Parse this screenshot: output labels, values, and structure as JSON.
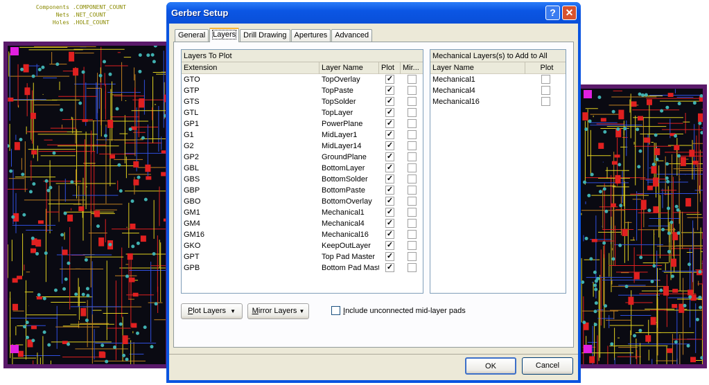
{
  "background": {
    "stats": [
      {
        "label": "Components",
        "value": ".COMPONENT_COUNT"
      },
      {
        "label": "Nets",
        "value": ".NET_COUNT"
      },
      {
        "label": "Holes",
        "value": ".HOLE_COUNT"
      }
    ],
    "colors": {
      "board_border": "#5a1a6a",
      "trace_yellow": "#e0d020",
      "trace_red": "#e02020",
      "trace_blue": "#3050e0",
      "pad_cyan": "#40b0b0",
      "pad_magenta": "#e020e0"
    }
  },
  "dialog": {
    "title": "Gerber Setup",
    "help_label": "?",
    "close_label": "✕",
    "tabs": [
      {
        "label": "General",
        "active": false
      },
      {
        "label": "Layers",
        "active": true
      },
      {
        "label": "Drill Drawing",
        "active": false
      },
      {
        "label": "Apertures",
        "active": false
      },
      {
        "label": "Advanced",
        "active": false
      }
    ],
    "layers_to_plot": {
      "group_title": "Layers To Plot",
      "columns": [
        "Extension",
        "Layer Name",
        "Plot",
        "Mir..."
      ],
      "rows": [
        {
          "ext": "GTO",
          "name": "TopOverlay",
          "plot": true,
          "mirror": false
        },
        {
          "ext": "GTP",
          "name": "TopPaste",
          "plot": true,
          "mirror": false
        },
        {
          "ext": "GTS",
          "name": "TopSolder",
          "plot": true,
          "mirror": false
        },
        {
          "ext": "GTL",
          "name": "TopLayer",
          "plot": true,
          "mirror": false
        },
        {
          "ext": "GP1",
          "name": "PowerPlane",
          "plot": true,
          "mirror": false
        },
        {
          "ext": "G1",
          "name": "MidLayer1",
          "plot": true,
          "mirror": false
        },
        {
          "ext": "G2",
          "name": "MidLayer14",
          "plot": true,
          "mirror": false
        },
        {
          "ext": "GP2",
          "name": "GroundPlane",
          "plot": true,
          "mirror": false
        },
        {
          "ext": "GBL",
          "name": "BottomLayer",
          "plot": true,
          "mirror": false
        },
        {
          "ext": "GBS",
          "name": "BottomSolder",
          "plot": true,
          "mirror": false
        },
        {
          "ext": "GBP",
          "name": "BottomPaste",
          "plot": true,
          "mirror": false
        },
        {
          "ext": "GBO",
          "name": "BottomOverlay",
          "plot": true,
          "mirror": false
        },
        {
          "ext": "GM1",
          "name": "Mechanical1",
          "plot": true,
          "mirror": false
        },
        {
          "ext": "GM4",
          "name": "Mechanical4",
          "plot": true,
          "mirror": false
        },
        {
          "ext": "GM16",
          "name": "Mechanical16",
          "plot": true,
          "mirror": false
        },
        {
          "ext": "GKO",
          "name": "KeepOutLayer",
          "plot": true,
          "mirror": false
        },
        {
          "ext": "GPT",
          "name": "Top Pad Master",
          "plot": true,
          "mirror": false
        },
        {
          "ext": "GPB",
          "name": "Bottom Pad Master",
          "plot": true,
          "mirror": false
        }
      ]
    },
    "mechanical_layers": {
      "group_title": "Mechanical Layers(s) to Add to All Plots",
      "columns": [
        "Layer Name",
        "Plot"
      ],
      "rows": [
        {
          "name": "Mechanical1",
          "plot": false
        },
        {
          "name": "Mechanical4",
          "plot": false
        },
        {
          "name": "Mechanical16",
          "plot": false
        }
      ]
    },
    "plot_layers_button": {
      "mnemonic": "P",
      "rest": "lot Layers",
      "arrow": "▼"
    },
    "mirror_layers_button": {
      "mnemonic": "M",
      "rest": "irror Layers",
      "arrow": "▼"
    },
    "include_unconnected": {
      "mnemonic": "I",
      "rest": "nclude unconnected mid-layer pads",
      "checked": false
    },
    "ok_label": "OK",
    "cancel_label": "Cancel"
  }
}
